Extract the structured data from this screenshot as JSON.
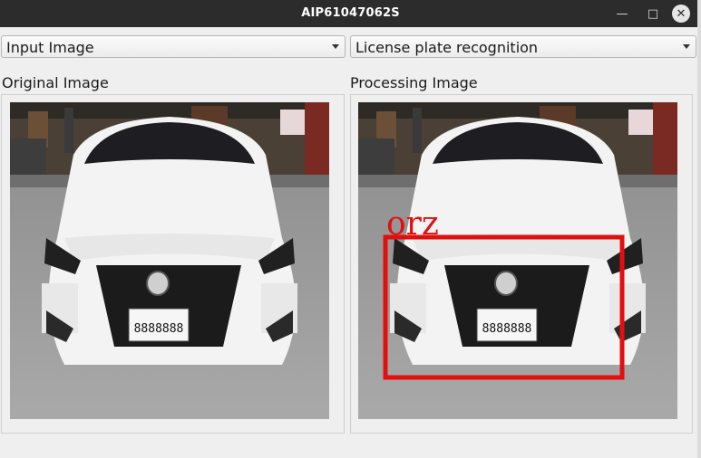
{
  "window": {
    "title": "AIP61047062S"
  },
  "controls": {
    "input_select": "Input Image",
    "mode_select": "License plate recognition"
  },
  "panels": {
    "original_title": "Original Image",
    "processing_title": "Processing Image"
  },
  "detection": {
    "label": "orz",
    "box_color": "#e01010",
    "plate_text": "8888888"
  },
  "colors": {
    "titlebar": "#2c2c2c",
    "window_bg": "#efefef",
    "car_body": "#f3f3f3"
  }
}
